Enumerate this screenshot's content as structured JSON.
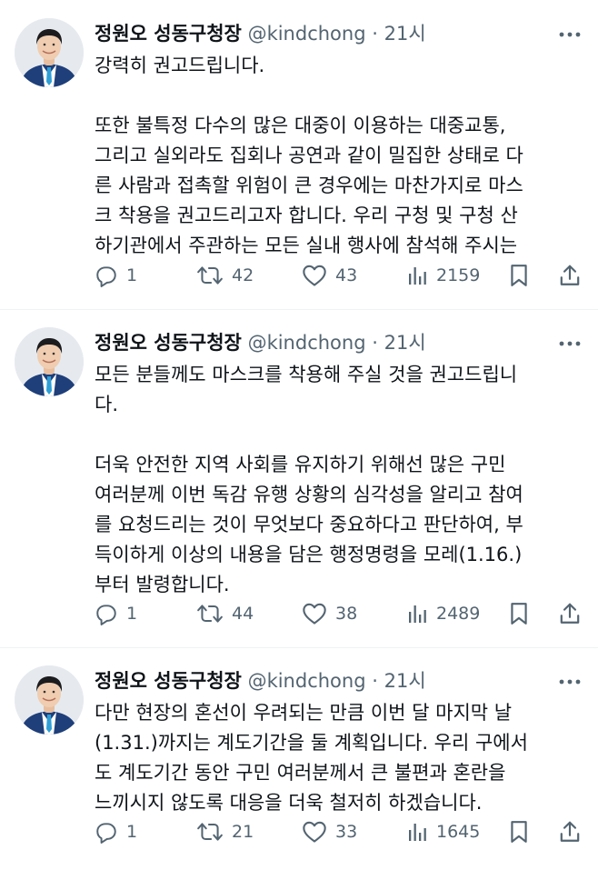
{
  "colors": {
    "text": "#0f1419",
    "secondary": "#536471",
    "divider": "#eff3f4"
  },
  "tweets": [
    {
      "author": "정원오 성동구청장",
      "handle": "@kindchong",
      "separator": "·",
      "time": "21시",
      "lines": [
        "강력히 권고드립니다.",
        "",
        "또한 불특정 다수의 많은 대중이 이용하는 대중교통,",
        "그리고 실외라도 집회나 공연과 같이 밀집한 상태로 다",
        "른 사람과 접촉할 위험이 큰 경우에는 마찬가지로 마스",
        "크 착용을 권고드리고자 합니다. 우리 구청 및 구청 산",
        "하기관에서 주관하는 모든 실내 행사에 참석해 주시는"
      ],
      "replies": "1",
      "retweets": "42",
      "likes": "43",
      "views": "2159"
    },
    {
      "author": "정원오 성동구청장",
      "handle": "@kindchong",
      "separator": "·",
      "time": "21시",
      "lines": [
        "모든 분들께도 마스크를 착용해 주실 것을 권고드립니",
        "다.",
        "",
        "더욱 안전한 지역 사회를 유지하기 위해선 많은 구민",
        "여러분께 이번 독감 유행 상황의 심각성을 알리고 참여",
        "를 요청드리는 것이 무엇보다 중요하다고 판단하여, 부",
        "득이하게 이상의 내용을 담은 행정명령을 모레(1.16.)",
        "부터 발령합니다."
      ],
      "replies": "1",
      "retweets": "44",
      "likes": "38",
      "views": "2489"
    },
    {
      "author": "정원오 성동구청장",
      "handle": "@kindchong",
      "separator": "·",
      "time": "21시",
      "lines": [
        "다만 현장의 혼선이 우려되는 만큼 이번 달 마지막 날",
        "(1.31.)까지는 계도기간을 둘 계획입니다. 우리 구에서",
        "도 계도기간 동안 구민 여러분께서 큰 불편과 혼란을",
        "느끼시지 않도록 대응을 더욱 철저히 하겠습니다."
      ],
      "replies": "1",
      "retweets": "21",
      "likes": "33",
      "views": "1645"
    }
  ]
}
